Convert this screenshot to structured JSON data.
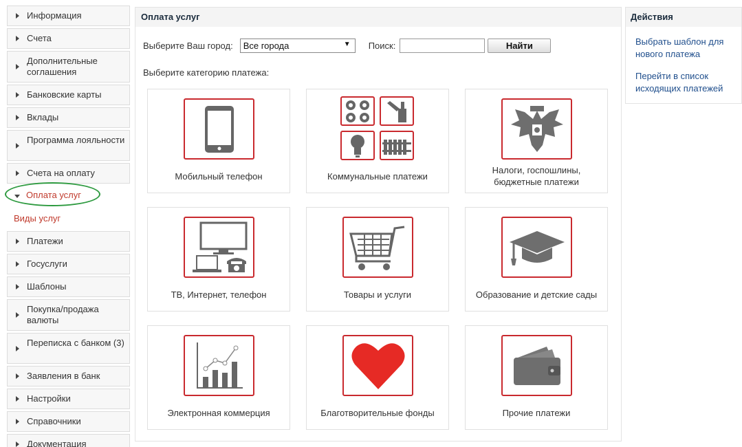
{
  "sidebar": {
    "items": [
      {
        "label": "Информация"
      },
      {
        "label": "Счета"
      },
      {
        "label": "Дополнительные соглашения"
      },
      {
        "label": "Банковские карты"
      },
      {
        "label": "Вклады"
      },
      {
        "label": "Программа лояльности"
      },
      {
        "label": "Счета на оплату"
      },
      {
        "label": "Оплата услуг"
      },
      {
        "label": "Платежи"
      },
      {
        "label": "Госуслуги"
      },
      {
        "label": "Шаблоны"
      },
      {
        "label": "Покупка/продажа валюты"
      },
      {
        "label": "Переписка с банком (3)"
      },
      {
        "label": "Заявления в банк"
      },
      {
        "label": "Настройки"
      },
      {
        "label": "Справочники"
      },
      {
        "label": "Документация"
      }
    ],
    "subitem": "Виды услуг"
  },
  "main": {
    "title": "Оплата услуг",
    "city_label": "Выберите Ваш город:",
    "city_value": "Все города",
    "city_arrow": "▼",
    "search_label": "Поиск:",
    "search_value": "",
    "find_button": "Найти",
    "category_label": "Выберите категорию платежа:",
    "categories": [
      {
        "label": "Мобильный телефон",
        "icon": "mobile-phone-icon"
      },
      {
        "label": "Коммунальные платежи",
        "icon": "utilities-icon"
      },
      {
        "label": "Налоги, госпошлины, бюджетные платежи",
        "icon": "coat-of-arms-icon"
      },
      {
        "label": "ТВ, Интернет, телефон",
        "icon": "tv-internet-phone-icon"
      },
      {
        "label": "Товары и услуги",
        "icon": "shopping-cart-icon"
      },
      {
        "label": "Образование и детские сады",
        "icon": "graduation-cap-icon"
      },
      {
        "label": "Электронная коммерция",
        "icon": "growth-chart-icon"
      },
      {
        "label": "Благотворительные фонды",
        "icon": "heart-icon"
      },
      {
        "label": "Прочие платежи",
        "icon": "wallet-icon"
      }
    ]
  },
  "actions": {
    "title": "Действия",
    "links": [
      "Выбрать шаблон для нового платежа",
      "Перейти в список исходящих платежей"
    ]
  },
  "colors": {
    "accent_red": "#c9292e",
    "highlight_green": "#2d9a3f",
    "link_blue": "#1f4e8c",
    "icon_gray": "#6e6e6e",
    "heart_red": "#e62a25"
  }
}
